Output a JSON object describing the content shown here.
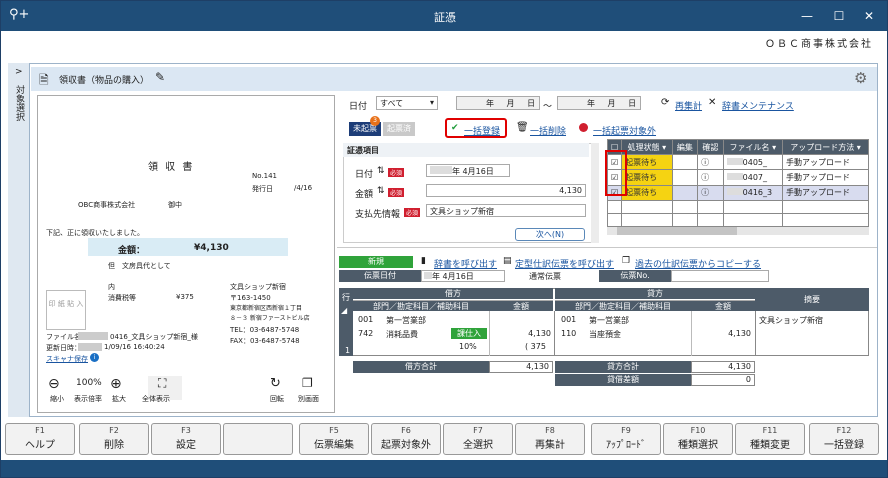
{
  "window": {
    "title": "証憑",
    "company": "ＯＢＣ商事株式会社"
  },
  "doc": {
    "title": "領収書（物品の購入）"
  },
  "sidebar": {
    "label": "対象選択"
  },
  "filter": {
    "date_label": "日付",
    "date_value": "すべて",
    "year": "年",
    "month": "月",
    "day": "日",
    "tilde": "〜",
    "recalc": "再集計",
    "dict": "辞書メンテナンス"
  },
  "tabs": {
    "unprocessed": "未起票",
    "count": "3",
    "processed": "起票済"
  },
  "actions": {
    "bulk_register": "一括登録",
    "bulk_delete": "一括削除",
    "bulk_exclude": "一括起票対象外"
  },
  "voucher": {
    "section": "証憑項目",
    "date_label": "日付",
    "date_value": "年 4月16日",
    "amount_label": "金額",
    "amount_value": "4,130",
    "payee_label": "支払先情報",
    "payee_value": "文具ショップ新宿",
    "next": "次へ(N)",
    "required": "必須"
  },
  "file_table": {
    "headers": [
      "処理状態",
      "編集",
      "確認",
      "ファイル名",
      "アップロード方法"
    ],
    "rows": [
      {
        "status": "起票待ち",
        "file": "0405_",
        "method": "手動アップロード"
      },
      {
        "status": "起票待ち",
        "file": "0407_",
        "method": "手動アップロード"
      },
      {
        "status": "起票待ち",
        "file": "0416_3",
        "method": "手動アップロード"
      }
    ]
  },
  "slip": {
    "new": "新規",
    "dict_call": "辞書を呼び出す",
    "template_call": "定型仕訳伝票を呼び出す",
    "copy_past": "過去の仕訳伝票からコピーする",
    "date_label": "伝票日付",
    "date_value": "年 4月16日",
    "slip_type": "通常伝票",
    "slip_no": "伝票No."
  },
  "journal": {
    "row_hdr": "行",
    "debit": "借方",
    "credit": "貸方",
    "memo": "摘要",
    "dept_hdr": "部門／勘定科目／補助科目",
    "amount_hdr": "金額",
    "row_no": "1",
    "d_dept_code": "001",
    "d_dept": "第一営業部",
    "d_acct_code": "742",
    "d_acct": "消耗品費",
    "tax": "課仕入",
    "d_amount": "4,130",
    "tax_rate": "10%",
    "tax_amount": "( 375",
    "c_dept_code": "001",
    "c_dept": "第一営業部",
    "c_acct_code": "110",
    "c_acct": "当座預金",
    "c_amount": "4,130",
    "memo_value": "文具ショップ新宿",
    "debit_total_label": "借方合計",
    "debit_total": "4,130",
    "credit_total_label": "貸方合計",
    "credit_total": "4,130",
    "diff_label": "貸借差額",
    "diff": "0"
  },
  "preview": {
    "title": "領 収 書",
    "no": "No.141",
    "issue_date": "発行日",
    "issue_date_val": "/4/16",
    "to": "OBC商事株式会社",
    "honorific": "御中",
    "received": "下記、正に領収いたしました。",
    "amount_label": "金額：",
    "amount": "¥4,130",
    "desc": "但　文房具代として",
    "tax_label": "内",
    "tax_name": "消費税等",
    "tax_amount": "¥375",
    "shop": "文具ショップ新宿",
    "zip": "〒163-1450",
    "addr1": "東京都新宿区西新宿１丁目",
    "addr2": "８－３ 新宿ファーストビル店",
    "tel": "TEL：03-6487-5748",
    "fax": "FAX：03-6487-5748",
    "stamp": "印 紙 貼 入",
    "file_label": "ファイル名：",
    "file_name": "0416_文具ショップ新宿_様",
    "updated_label": "更新日時：",
    "updated": "1/09/16 16:40:24",
    "scanner": "スキャナ保存"
  },
  "zoom": {
    "zoom_out": "縮小",
    "zoom_level": "100%",
    "zoom_level_label": "表示倍率",
    "zoom_in": "拡大",
    "fit": "全体表示",
    "rotate": "回転",
    "separate": "別画面"
  },
  "fkeys": [
    {
      "k": "F1",
      "l": "ヘルプ"
    },
    {
      "k": "F2",
      "l": "削除"
    },
    {
      "k": "F3",
      "l": "設定"
    },
    {
      "k": "",
      "l": ""
    },
    {
      "k": "F5",
      "l": "伝票編集"
    },
    {
      "k": "F6",
      "l": "起票対象外"
    },
    {
      "k": "F7",
      "l": "全選択"
    },
    {
      "k": "F8",
      "l": "再集計"
    },
    {
      "k": "F9",
      "l": "ｱｯﾌﾟﾛｰﾄﾞ"
    },
    {
      "k": "F10",
      "l": "種類選択"
    },
    {
      "k": "F11",
      "l": "種類変更"
    },
    {
      "k": "F12",
      "l": "一括登録"
    }
  ],
  "colors": {
    "titlebar": "#1f4e79",
    "status_yellow": "#f5d312",
    "highlight_red": "#e00000"
  }
}
